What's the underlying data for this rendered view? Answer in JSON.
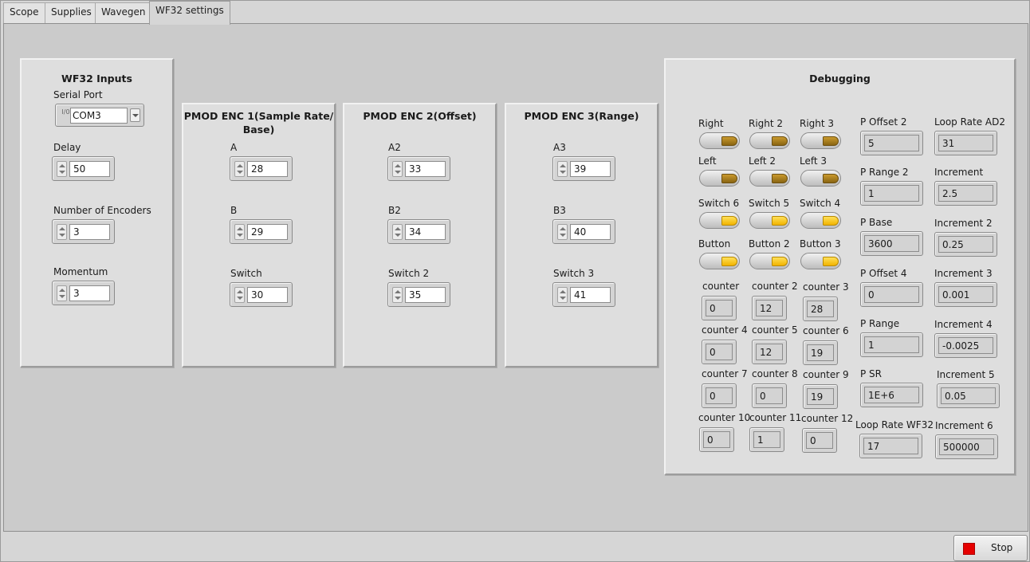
{
  "tabs": [
    "Scope",
    "Supplies",
    "Wavegen",
    "WF32 settings"
  ],
  "active_tab": "WF32 settings",
  "wf32_inputs": {
    "title": "WF32 Inputs",
    "serial_port_label": "Serial Port",
    "serial_port_value": "COM3",
    "serial_port_io_glyph": "I/0",
    "delay_label": "Delay",
    "delay_value": "50",
    "encoders_label": "Number of Encoders",
    "encoders_value": "3",
    "momentum_label": "Momentum",
    "momentum_value": "3"
  },
  "enc1": {
    "title": "PMOD ENC 1(Sample Rate/",
    "title2": "Base)",
    "a_label": "A",
    "a_value": "28",
    "b_label": "B",
    "b_value": "29",
    "sw_label": "Switch",
    "sw_value": "30"
  },
  "enc2": {
    "title": "PMOD ENC 2(Offset)",
    "a_label": "A2",
    "a_value": "33",
    "b_label": "B2",
    "b_value": "34",
    "sw_label": "Switch 2",
    "sw_value": "35"
  },
  "enc3": {
    "title": "PMOD ENC 3(Range)",
    "a_label": "A3",
    "a_value": "39",
    "b_label": "B3",
    "b_value": "40",
    "sw_label": "Switch 3",
    "sw_value": "41"
  },
  "debug": {
    "title": "Debugging",
    "leds": [
      {
        "label": "Right",
        "state": "off"
      },
      {
        "label": "Right 2",
        "state": "off"
      },
      {
        "label": "Right 3",
        "state": "off"
      },
      {
        "label": "Left",
        "state": "off"
      },
      {
        "label": "Left 2",
        "state": "off"
      },
      {
        "label": "Left 3",
        "state": "off"
      },
      {
        "label": "Switch 6",
        "state": "on"
      },
      {
        "label": "Switch 5",
        "state": "on"
      },
      {
        "label": "Switch 4",
        "state": "on"
      },
      {
        "label": "Button",
        "state": "on"
      },
      {
        "label": "Button 2",
        "state": "on"
      },
      {
        "label": "Button 3",
        "state": "on"
      }
    ],
    "counters": [
      {
        "label": "counter",
        "value": "0"
      },
      {
        "label": "counter 2",
        "value": "12"
      },
      {
        "label": "counter 3",
        "value": "28"
      },
      {
        "label": "counter 4",
        "value": "0"
      },
      {
        "label": "counter 5",
        "value": "12"
      },
      {
        "label": "counter 6",
        "value": "19"
      },
      {
        "label": "counter 7",
        "value": "0"
      },
      {
        "label": "counter 8",
        "value": "0"
      },
      {
        "label": "counter 9",
        "value": "19"
      },
      {
        "label": "counter 10",
        "value": "0"
      },
      {
        "label": "counter 11",
        "value": "1"
      },
      {
        "label": "counter 12",
        "value": "0"
      }
    ],
    "col1": [
      {
        "label": "P Offset 2",
        "value": "5"
      },
      {
        "label": "P Range 2",
        "value": "1"
      },
      {
        "label": "P Base",
        "value": "3600"
      },
      {
        "label": "P Offset 4",
        "value": "0"
      },
      {
        "label": "P Range",
        "value": "1"
      },
      {
        "label": "P SR",
        "value": "1E+6"
      },
      {
        "label": "Loop Rate WF32",
        "value": "17"
      }
    ],
    "col2": [
      {
        "label": "Loop Rate AD2",
        "value": "31"
      },
      {
        "label": "Increment",
        "value": "2.5"
      },
      {
        "label": "Increment 2",
        "value": "0.25"
      },
      {
        "label": "Increment 3",
        "value": "0.001"
      },
      {
        "label": "Increment 4",
        "value": "-0.0025"
      },
      {
        "label": "Increment 5",
        "value": "0.05"
      },
      {
        "label": "Increment 6",
        "value": "500000"
      }
    ]
  },
  "stop": {
    "label": "Stop",
    "color": "#e60000"
  }
}
